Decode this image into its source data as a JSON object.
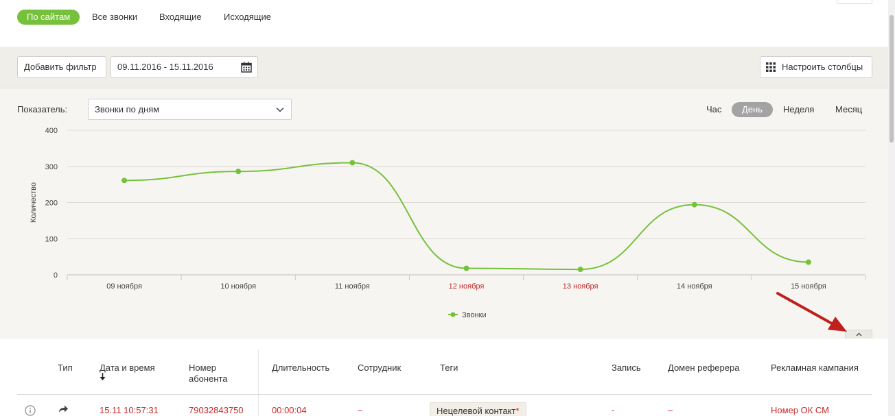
{
  "tabs": [
    {
      "label": "По сайтам",
      "active": true
    },
    {
      "label": "Все звонки",
      "active": false
    },
    {
      "label": "Входящие",
      "active": false
    },
    {
      "label": "Исходящие",
      "active": false
    }
  ],
  "filters": {
    "add_filter": "Добавить фильтр",
    "date_range": "09.11.2016 - 15.11.2016",
    "configure_columns": "Настроить столбцы"
  },
  "chart_controls": {
    "metric_label": "Показатель:",
    "metric_value": "Звонки по дням",
    "periods": [
      {
        "label": "Час",
        "active": false
      },
      {
        "label": "День",
        "active": true
      },
      {
        "label": "Неделя",
        "active": false
      },
      {
        "label": "Месяц",
        "active": false
      }
    ]
  },
  "chart_data": {
    "type": "line",
    "ylabel": "Количество",
    "xlabel": "",
    "categories": [
      "09 ноября",
      "10 ноября",
      "11 ноября",
      "12 ноября",
      "13 ноября",
      "14 ноября",
      "15 ноября"
    ],
    "weekend_categories": [
      "12 ноября",
      "13 ноября"
    ],
    "ylim": [
      0,
      400
    ],
    "yticks": [
      0,
      100,
      200,
      300,
      400
    ],
    "series": [
      {
        "name": "Звонки",
        "values": [
          261,
          286,
          310,
          18,
          15,
          194,
          35
        ],
        "color": "#76c13b"
      }
    ],
    "grid": true,
    "legend": "bottom-center"
  },
  "table": {
    "headers": {
      "type": "Тип",
      "datetime": "Дата и время",
      "number_line1": "Номер",
      "number_line2": "абонента",
      "duration": "Длительность",
      "employee": "Сотрудник",
      "tags": "Теги",
      "recording": "Запись",
      "referrer": "Домен реферера",
      "campaign": "Рекламная кампания"
    },
    "row": {
      "datetime": "15.11 10:57:31",
      "number": "79032843750",
      "duration": "00:00:04",
      "employee": "–",
      "tag": "Нецелевой контакт",
      "tag_mark": "*",
      "recording": "-",
      "referrer": "–",
      "campaign": "Номер ОК СМ"
    }
  },
  "colors": {
    "accent": "#76c13b",
    "weekend": "#c62828",
    "annotation_arrow": "#c0201c"
  },
  "icons": {
    "calendar": "calendar-icon",
    "columns": "grid-icon",
    "dropdown": "chevron-down-icon",
    "collapse": "chevron-up-icon",
    "sort": "sort-down-icon",
    "info": "info-icon",
    "call_type": "forward-arrow-icon"
  }
}
